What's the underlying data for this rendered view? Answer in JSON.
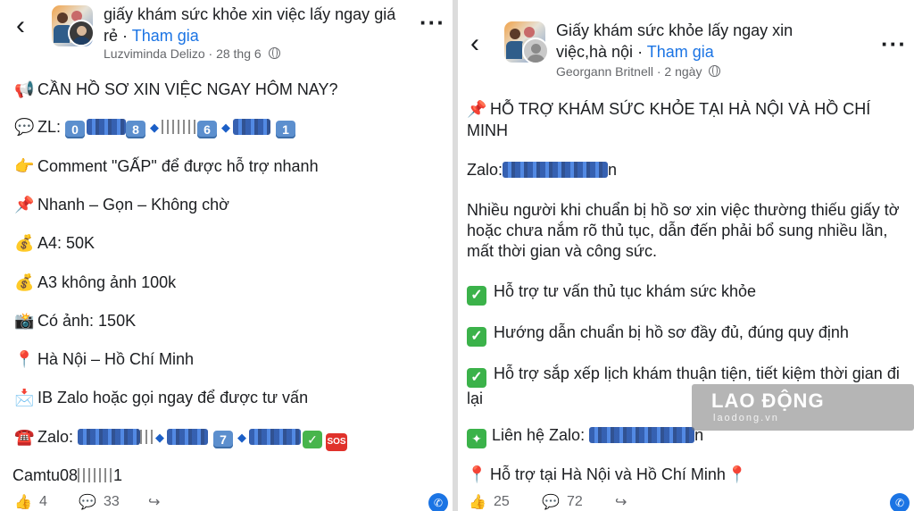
{
  "left_post": {
    "group_title": "giấy khám sức khỏe xin việc lấy ngay giá rẻ",
    "join_label": "Tham gia",
    "author": "Luzviminda Delizo",
    "time": "28 thg 6",
    "lines": {
      "l1": "CẦN HỒ SƠ XIN VIỆC NGAY HÔM NAY?",
      "zl_label": "ZL:",
      "l3": "Comment \"GẤP\" để được hỗ trợ nhanh",
      "l4": "Nhanh – Gọn – Không chờ",
      "l5": "A4: 50K",
      "l6": "A3 không ảnh 100k",
      "l7": "Có ảnh: 150K",
      "l8": "Hà Nội – Hồ Chí Minh",
      "l9": "IB Zalo hoặc gọi ngay để được tư vấn",
      "zalo_label": "Zalo:",
      "l11_prefix": "Camtu08",
      "l11_suffix": "1"
    },
    "reactions_count": "4",
    "comments_count": "33",
    "sos_text": "SOS"
  },
  "right_post": {
    "group_title": "Giấy khám sức khỏe lấy ngay xin việc,hà nội",
    "join_label": "Tham gia",
    "author": "Georgann Britnell",
    "time": "2 ngày",
    "lines": {
      "l1": "HỖ TRỢ KHÁM SỨC KHỎE TẠI HÀ NỘI VÀ HỒ CHÍ MINH",
      "zalo_prefix": "Zalo:",
      "zalo_suffix": "n",
      "para": "Nhiều người khi chuẩn bị hồ sơ xin việc thường thiếu giấy tờ hoặc chưa nắm rõ thủ tục, dẫn đến phải bổ sung nhiều lần, mất thời gian và công sức.",
      "c1": "Hỗ trợ tư vấn thủ tục khám sức khỏe",
      "c2": "Hướng dẫn chuẩn bị hồ sơ đầy đủ, đúng quy định",
      "c3": "Hỗ trợ sắp xếp lịch khám thuận tiện, tiết kiệm thời gian đi lại",
      "contact_label": "Liên hệ Zalo:",
      "contact_suffix": "n",
      "last": "Hỗ trợ tại Hà Nội và Hồ Chí Minh"
    },
    "reactions_count": "25",
    "comments_count": "72"
  },
  "watermark": {
    "brand": "LAO ĐỘNG",
    "domain": "laodong.vn"
  },
  "icons": {
    "back": "chevron-left-icon",
    "more": "more-horizontal-icon",
    "globe": "globe-icon",
    "like": "like-icon",
    "comment": "comment-icon",
    "share": "share-icon"
  },
  "colors": {
    "link_blue": "#1b74e4",
    "meta_gray": "#65676b",
    "keycap_blue": "#5c8fce",
    "check_green": "#3bb24a"
  }
}
